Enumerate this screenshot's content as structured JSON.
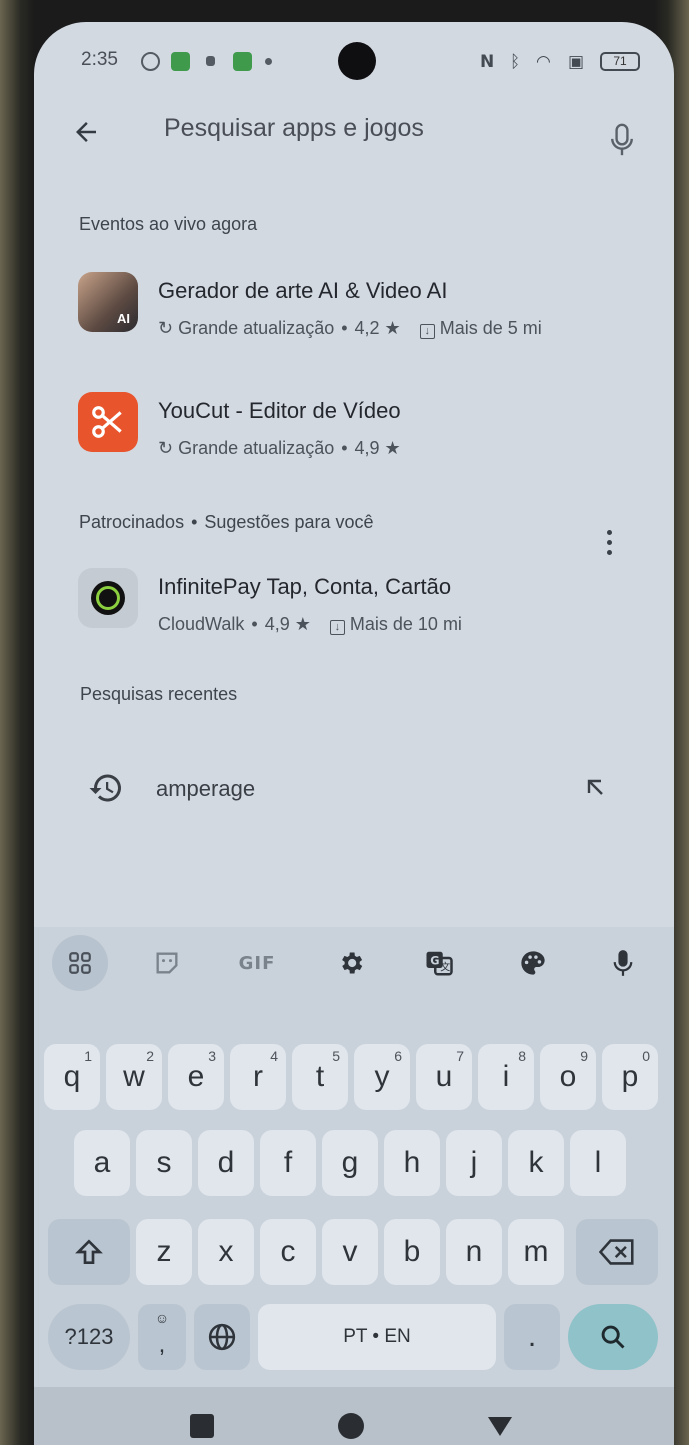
{
  "status_bar": {
    "time": "2:35",
    "battery": "71"
  },
  "search": {
    "placeholder": "Pesquisar apps e jogos"
  },
  "live_events": {
    "title": "Eventos ao vivo agora",
    "apps": [
      {
        "name": "Gerador de arte AI & Video AI",
        "update": "Grande atualização",
        "rating": "4,2 ★",
        "downloads": "Mais de 5 mi",
        "icon_text": "AI"
      },
      {
        "name": "YouCut - Editor de Vídeo",
        "update": "Grande atualização",
        "rating": "4,9 ★"
      }
    ]
  },
  "sponsored": {
    "title": "Patrocinados",
    "subtitle": "Sugestões para você",
    "apps": [
      {
        "name": "InfinitePay Tap, Conta, Cartão",
        "developer": "CloudWalk",
        "rating": "4,9 ★",
        "downloads": "Mais de 10 mi"
      }
    ]
  },
  "recent": {
    "title": "Pesquisas recentes",
    "items": [
      "amperage"
    ]
  },
  "keyboard": {
    "toolbar": {
      "gif": "GIF"
    },
    "row1": [
      {
        "k": "q",
        "n": "1"
      },
      {
        "k": "w",
        "n": "2"
      },
      {
        "k": "e",
        "n": "3"
      },
      {
        "k": "r",
        "n": "4"
      },
      {
        "k": "t",
        "n": "5"
      },
      {
        "k": "y",
        "n": "6"
      },
      {
        "k": "u",
        "n": "7"
      },
      {
        "k": "i",
        "n": "8"
      },
      {
        "k": "o",
        "n": "9"
      },
      {
        "k": "p",
        "n": "0"
      }
    ],
    "row2": [
      "a",
      "s",
      "d",
      "f",
      "g",
      "h",
      "j",
      "k",
      "l"
    ],
    "row3": [
      "z",
      "x",
      "c",
      "v",
      "b",
      "n",
      "m"
    ],
    "symbols": "?123",
    "comma": ",",
    "space": "PT • EN",
    "period": "."
  },
  "colors": {
    "screen_bg": "#d3d9e1",
    "keyboard_bg": "#c9d1da",
    "key_bg": "#e1e6ec",
    "accent": "#8fc2c9"
  }
}
